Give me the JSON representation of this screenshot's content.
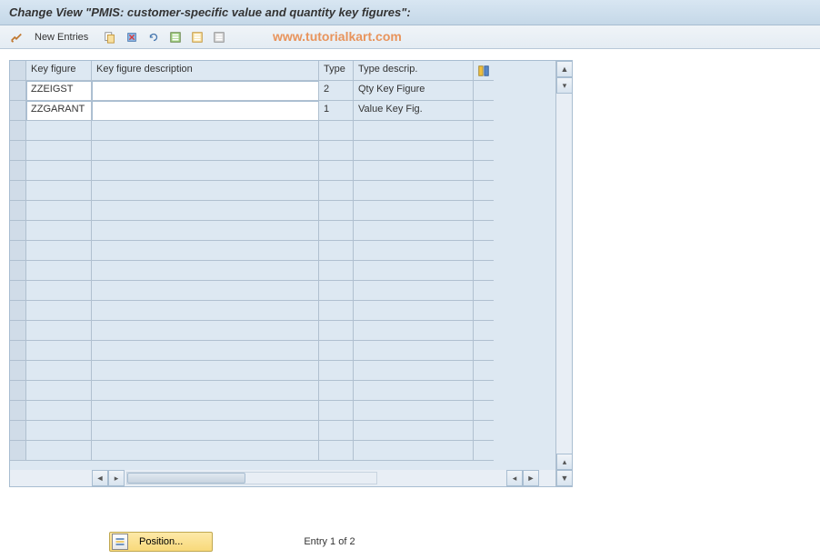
{
  "header": {
    "title": "Change View \"PMIS: customer-specific value and quantity key figures\":"
  },
  "toolbar": {
    "new_entries_label": "New Entries",
    "watermark": "www.tutorialkart.com"
  },
  "table": {
    "columns": {
      "key_figure": "Key figure",
      "description": "Key figure description",
      "type": "Type",
      "type_desc": "Type descrip."
    },
    "rows": [
      {
        "key_figure": "ZZEIGST",
        "description": "",
        "type": "2",
        "type_desc": "Qty Key Figure"
      },
      {
        "key_figure": "ZZGARANT",
        "description": "",
        "type": "1",
        "type_desc": "Value Key Fig."
      }
    ]
  },
  "footer": {
    "position_label": "Position...",
    "entry_text": "Entry 1 of 2"
  }
}
